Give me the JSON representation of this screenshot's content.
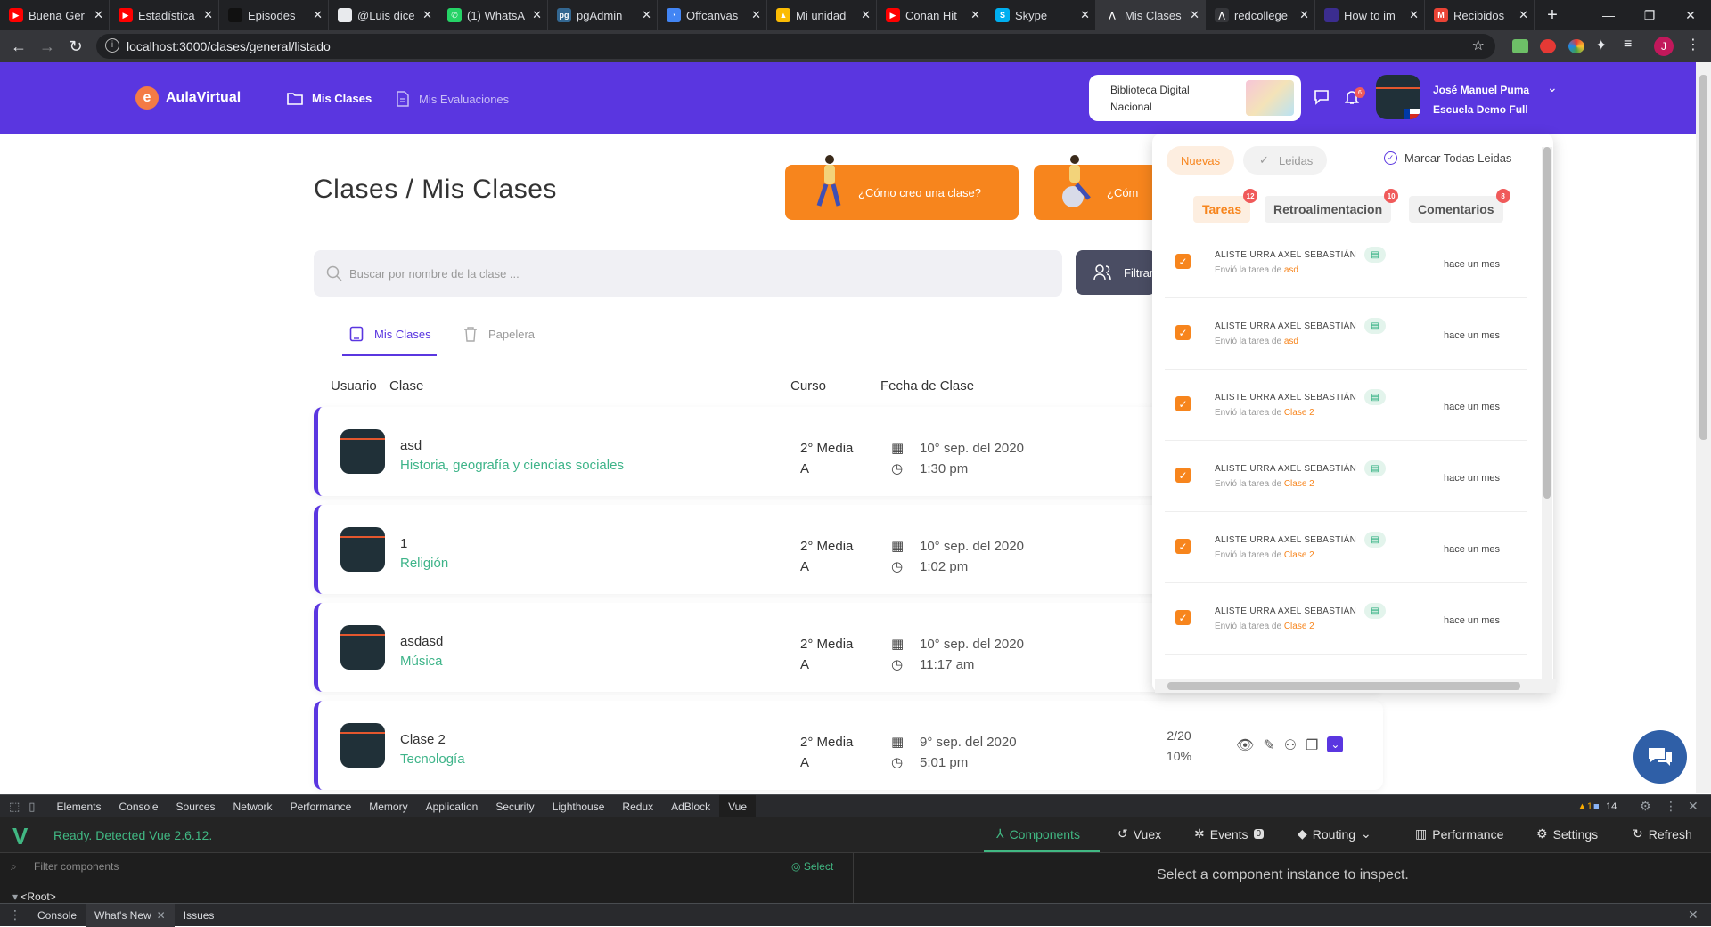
{
  "browser": {
    "tabs": [
      {
        "title": "Buena Ger",
        "fav_color": "#ff0000",
        "fav": "▶"
      },
      {
        "title": "Estadística",
        "fav_color": "#ff0000",
        "fav": "▶"
      },
      {
        "title": "Episodes",
        "fav_color": "#111111",
        "fav": ""
      },
      {
        "title": "@Luis dice",
        "fav_color": "#e8eaed",
        "fav": ""
      },
      {
        "title": "(1) WhatsA",
        "fav_color": "#25d366",
        "fav": "✆"
      },
      {
        "title": "pgAdmin",
        "fav_color": "#336791",
        "fav": "pg"
      },
      {
        "title": "Offcanvas",
        "fav_color": "#4285f4",
        "fav": "◔"
      },
      {
        "title": "Mi unidad",
        "fav_color": "#fbbc04",
        "fav": "▲"
      },
      {
        "title": "Conan Hit",
        "fav_color": "#ff0000",
        "fav": "▶"
      },
      {
        "title": "Skype",
        "fav_color": "#00aff0",
        "fav": "S"
      },
      {
        "title": "Mis Clases",
        "fav_color": "#35363a",
        "fav": "⋀",
        "active": true
      },
      {
        "title": "redcollege",
        "fav_color": "#35363a",
        "fav": "⋀"
      },
      {
        "title": "How to im",
        "fav_color": "#3b2d8f",
        "fav": ""
      },
      {
        "title": "Recibidos",
        "fav_color": "#ea4335",
        "fav": "M"
      }
    ],
    "new_tab": "+",
    "url": "localhost:3000/clases/general/listado"
  },
  "header": {
    "logo_letter": "e",
    "logo_text": "AulaVirtual",
    "nav": [
      {
        "label": "Mis Clases"
      },
      {
        "label": "Mis Evaluaciones"
      }
    ],
    "biblioteca_line1": "Biblioteca Digital",
    "biblioteca_line2": "Nacional",
    "notif_count": "6",
    "user_name": "José Manuel Puma",
    "user_school": "Escuela Demo Full"
  },
  "page": {
    "title": "Clases / Mis Clases",
    "help_button_1": "¿Cómo creo una clase?",
    "help_button_2": "¿Cóm",
    "search_placeholder": "Buscar por nombre de la clase ...",
    "filter_label": "Filtrar",
    "subtabs": [
      {
        "label": "Mis Clases"
      },
      {
        "label": "Papelera"
      }
    ],
    "columns": {
      "usuario": "Usuario",
      "clase": "Clase",
      "curso": "Curso",
      "fecha": "Fecha de Clase"
    },
    "rows": [
      {
        "name": "asd",
        "subject": "Historia, geografía y ciencias sociales",
        "curso_line1": "2° Media",
        "curso_line2": "A",
        "date": "10° sep. del 2020",
        "time": "1:30 pm"
      },
      {
        "name": "1",
        "subject": "Religión",
        "curso_line1": "2° Media",
        "curso_line2": "A",
        "date": "10° sep. del 2020",
        "time": "1:02 pm"
      },
      {
        "name": "asdasd",
        "subject": "Música",
        "curso_line1": "2° Media",
        "curso_line2": "A",
        "date": "10° sep. del 2020",
        "time": "11:17 am"
      },
      {
        "name": "Clase 2",
        "subject": "Tecnología",
        "curso_line1": "2° Media",
        "curso_line2": "A",
        "date": "9° sep. del 2020",
        "time": "5:01 pm",
        "count": "2/20",
        "percent": "10%"
      }
    ]
  },
  "notifications": {
    "pill_new": "Nuevas",
    "pill_read": "Leidas",
    "mark_all": "Marcar Todas Leidas",
    "tabs": [
      {
        "label": "Tareas",
        "badge": "12"
      },
      {
        "label": "Retroalimentacion",
        "badge": "10"
      },
      {
        "label": "Comentarios",
        "badge": "8"
      }
    ],
    "items": [
      {
        "name": "ALISTE URRA AXEL SEBASTIÁN",
        "desc": "Envió la tarea de ",
        "link": "asd",
        "time": "hace un mes"
      },
      {
        "name": "ALISTE URRA AXEL SEBASTIÁN",
        "desc": "Envió la tarea de ",
        "link": "asd",
        "time": "hace un mes"
      },
      {
        "name": "ALISTE URRA AXEL SEBASTIÁN",
        "desc": "Envió la tarea de ",
        "link": "Clase 2",
        "time": "hace un mes"
      },
      {
        "name": "ALISTE URRA AXEL SEBASTIÁN",
        "desc": "Envió la tarea de ",
        "link": "Clase 2",
        "time": "hace un mes"
      },
      {
        "name": "ALISTE URRA AXEL SEBASTIÁN",
        "desc": "Envió la tarea de ",
        "link": "Clase 2",
        "time": "hace un mes"
      },
      {
        "name": "ALISTE URRA AXEL SEBASTIÁN",
        "desc": "Envió la tarea de ",
        "link": "Clase 2",
        "time": "hace un mes"
      }
    ]
  },
  "devtools": {
    "tabs": [
      "Elements",
      "Console",
      "Sources",
      "Network",
      "Performance",
      "Memory",
      "Application",
      "Security",
      "Lighthouse",
      "Redux",
      "AdBlock",
      "Vue"
    ],
    "warnings": "▲1",
    "messages": "14",
    "vue_ready": "Ready. Detected Vue 2.6.12.",
    "vue_tabs": [
      "Components",
      "Vuex",
      "Events",
      "Routing",
      "Performance",
      "Settings",
      "Refresh"
    ],
    "events_count": "0",
    "filter_placeholder": "Filter components",
    "select_label": "Select",
    "root_label": "<Root>",
    "inspect_msg": "Select a component instance to inspect.",
    "drawer_tabs": [
      "Console",
      "What's New",
      "Issues"
    ]
  }
}
